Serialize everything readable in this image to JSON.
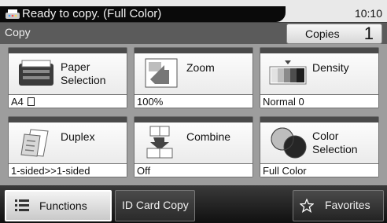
{
  "status": {
    "message": "Ready to copy. (Full Color)",
    "time": "10:10"
  },
  "header": {
    "title": "Copy",
    "copies_label": "Copies",
    "copies_value": "1"
  },
  "tiles": [
    {
      "label_line1": "Paper",
      "label_line2": "Selection",
      "value": "A4",
      "icon": "paper-tray-icon"
    },
    {
      "label_line1": "Zoom",
      "label_line2": "",
      "value": "100%",
      "icon": "zoom-icon"
    },
    {
      "label_line1": "Density",
      "label_line2": "",
      "value": "Normal 0",
      "icon": "density-icon"
    },
    {
      "label_line1": "Duplex",
      "label_line2": "",
      "value": "1-sided>>1-sided",
      "icon": "duplex-icon"
    },
    {
      "label_line1": "Combine",
      "label_line2": "",
      "value": "Off",
      "icon": "combine-icon"
    },
    {
      "label_line1": "Color",
      "label_line2": "Selection",
      "value": "Full Color",
      "icon": "color-selection-icon"
    }
  ],
  "bottom": {
    "functions_label": "Functions",
    "idcard_label": "ID Card Copy",
    "favorites_label": "Favorites"
  },
  "colors": {
    "status_background": "#0a0a0a",
    "panel_background": "#9d9d9d",
    "tile_header": "#4a4a4a"
  }
}
